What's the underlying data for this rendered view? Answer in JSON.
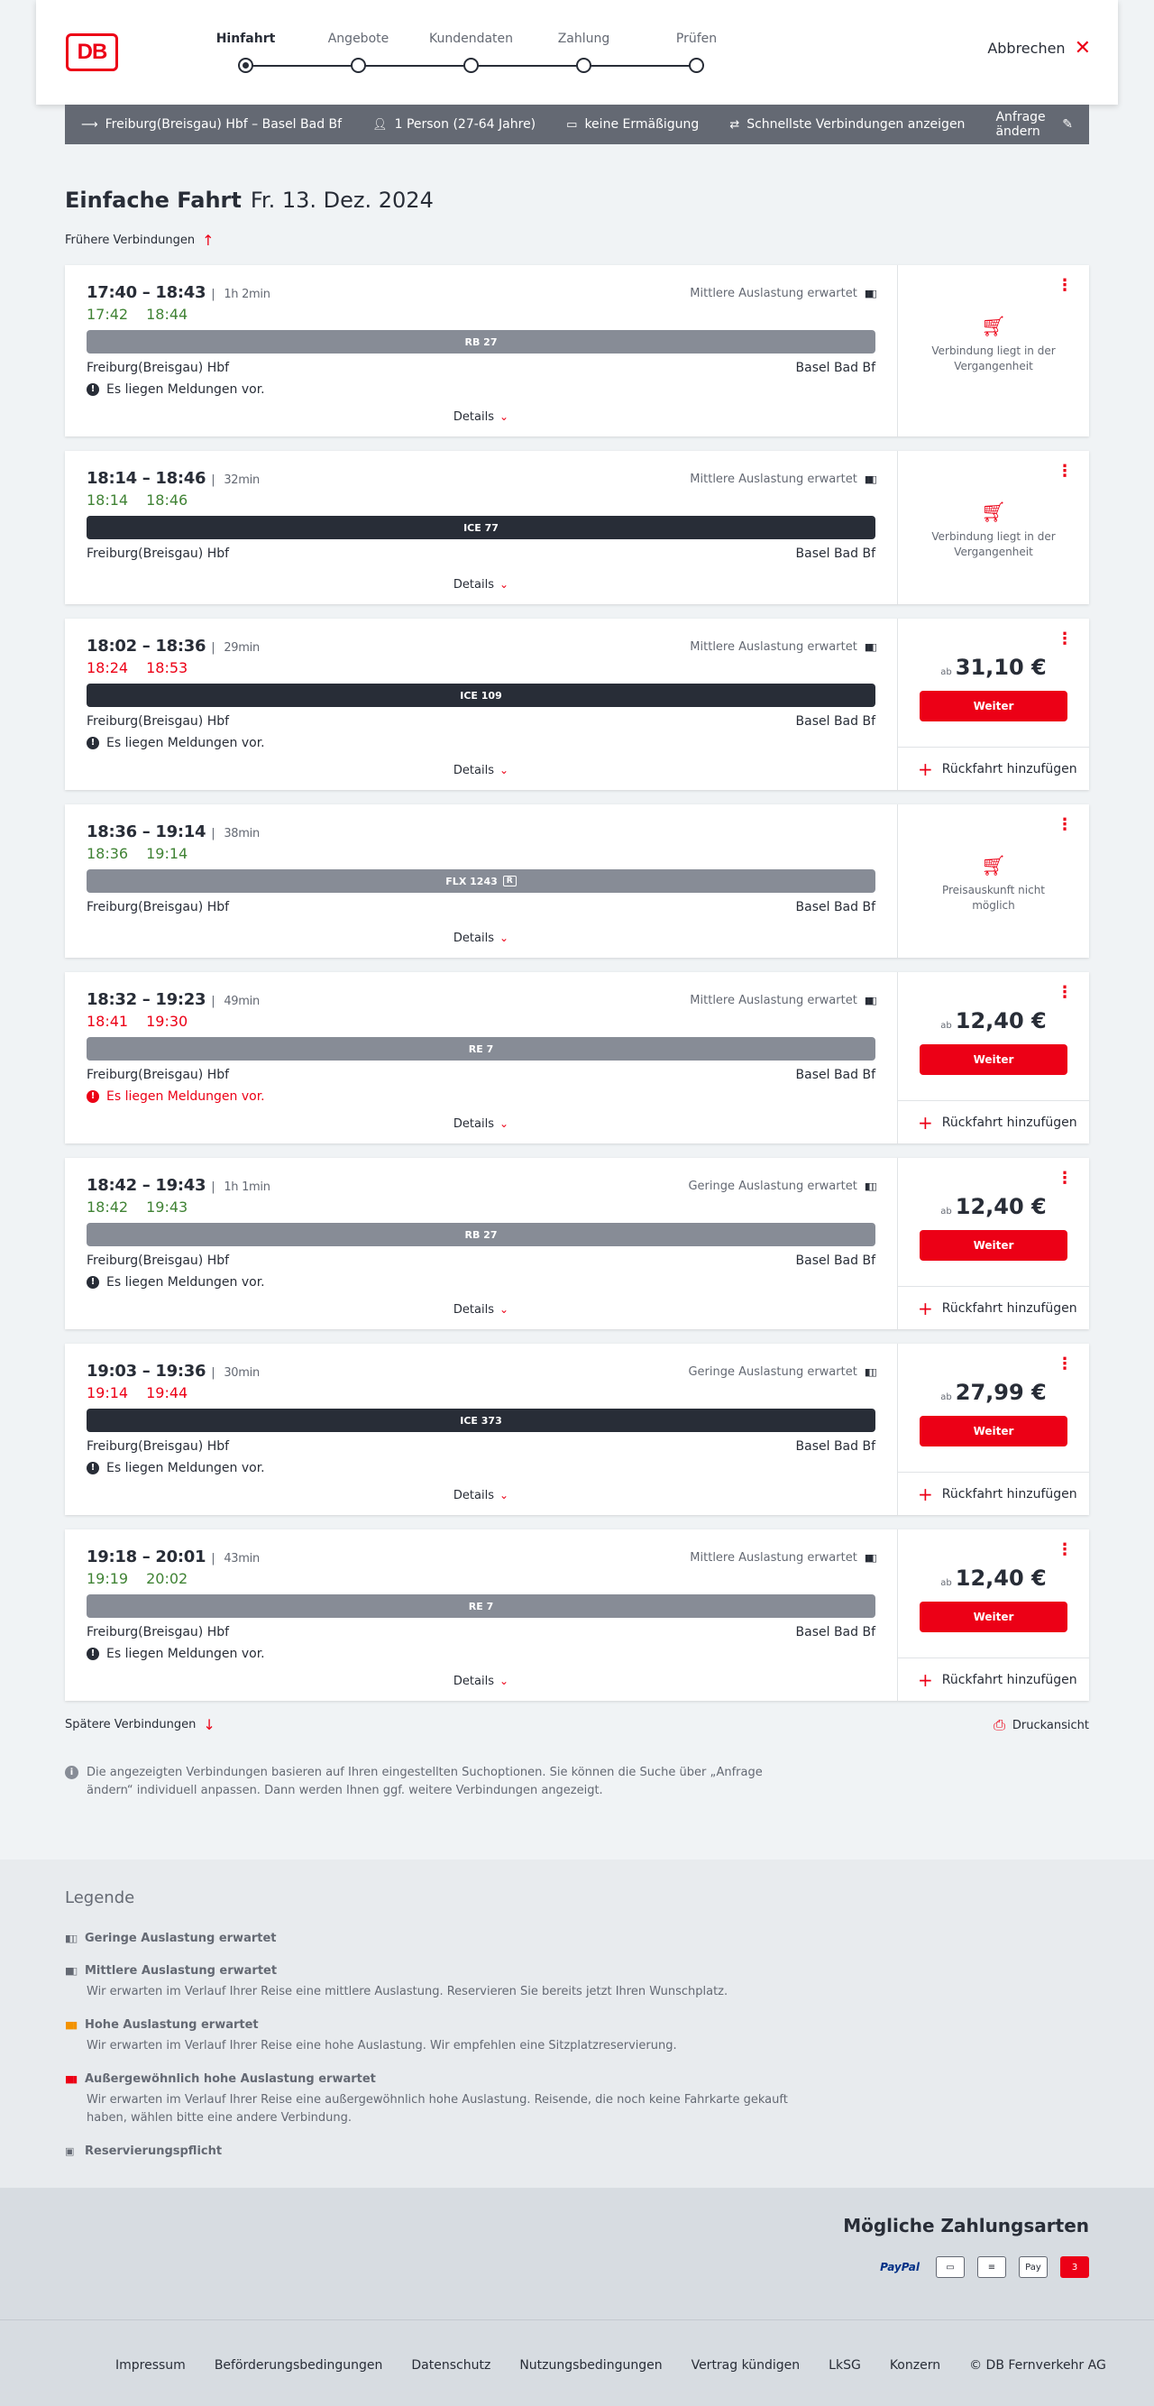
{
  "header": {
    "logo": "DB",
    "steps": [
      {
        "label": "Hinfahrt",
        "active": true
      },
      {
        "label": "Angebote",
        "active": false
      },
      {
        "label": "Kundendaten",
        "active": false
      },
      {
        "label": "Zahlung",
        "active": false
      },
      {
        "label": "Prüfen",
        "active": false
      }
    ],
    "cancel_label": "Abbrechen"
  },
  "searchbar": {
    "route": "Freiburg(Breisgau) Hbf – Basel Bad Bf",
    "travellers": "1 Person (27-64 Jahre)",
    "discount": "keine Ermäßigung",
    "option": "Schnellste Verbindungen anzeigen",
    "change": "Anfrage ändern"
  },
  "title": {
    "main": "Einfache Fahrt",
    "date": "Fr. 13. Dez. 2024"
  },
  "earlier_label": "Frühere Verbindungen",
  "later_label": "Spätere Verbindungen",
  "print_label": "Druckansicht",
  "labels": {
    "details": "Details",
    "weiter": "Weiter",
    "ab": "ab",
    "return": "Rückfahrt hinzufügen"
  },
  "connections": [
    {
      "times": "17:40 – 18:43",
      "duration": "1h 2min",
      "load": "Mittlere Auslastung erwartet",
      "rt_dep": "17:42",
      "rt_arr": "18:44",
      "dep_status": "ok",
      "arr_status": "ok",
      "train": "RB 27",
      "bar": "grey",
      "from": "Freiburg(Breisgau) Hbf",
      "to": "Basel Bad Bf",
      "message": "Es liegen Meldungen vor.",
      "msg_red": false,
      "state": "na",
      "na_text": "Verbindung liegt in der Vergangenheit"
    },
    {
      "times": "18:14 – 18:46",
      "duration": "32min",
      "load": "Mittlere Auslastung erwartet",
      "rt_dep": "18:14",
      "rt_arr": "18:46",
      "dep_status": "ok",
      "arr_status": "ok",
      "train": "ICE 77",
      "bar": "dark",
      "from": "Freiburg(Breisgau) Hbf",
      "to": "Basel Bad Bf",
      "message": "",
      "msg_red": false,
      "state": "na",
      "na_text": "Verbindung liegt in der Vergangenheit"
    },
    {
      "times": "18:02 – 18:36",
      "duration": "29min",
      "load": "Mittlere Auslastung erwartet",
      "rt_dep": "18:24",
      "rt_arr": "18:53",
      "dep_status": "late",
      "arr_status": "late",
      "train": "ICE 109",
      "bar": "dark",
      "from": "Freiburg(Breisgau) Hbf",
      "to": "Basel Bad Bf",
      "message": "Es liegen Meldungen vor.",
      "msg_red": false,
      "state": "price",
      "price": "31,10 €"
    },
    {
      "times": "18:36 – 19:14",
      "duration": "38min",
      "load": "",
      "rt_dep": "18:36",
      "rt_arr": "19:14",
      "dep_status": "ok",
      "arr_status": "ok",
      "train": "FLX 1243",
      "train_badge": "R",
      "bar": "grey",
      "from": "Freiburg(Breisgau) Hbf",
      "to": "Basel Bad Bf",
      "message": "",
      "msg_red": false,
      "state": "na",
      "na_text": "Preisauskunft nicht möglich"
    },
    {
      "times": "18:32 – 19:23",
      "duration": "49min",
      "load": "Mittlere Auslastung erwartet",
      "rt_dep": "18:41",
      "rt_arr": "19:30",
      "dep_status": "late",
      "arr_status": "late",
      "train": "RE 7",
      "bar": "grey",
      "from": "Freiburg(Breisgau) Hbf",
      "to": "Basel Bad Bf",
      "message": "Es liegen Meldungen vor.",
      "msg_red": true,
      "state": "price",
      "price": "12,40 €"
    },
    {
      "times": "18:42 – 19:43",
      "duration": "1h 1min",
      "load": "Geringe Auslastung erwartet",
      "rt_dep": "18:42",
      "rt_arr": "19:43",
      "dep_status": "ok",
      "arr_status": "ok",
      "train": "RB 27",
      "bar": "grey",
      "from": "Freiburg(Breisgau) Hbf",
      "to": "Basel Bad Bf",
      "message": "Es liegen Meldungen vor.",
      "msg_red": false,
      "state": "price",
      "price": "12,40 €"
    },
    {
      "times": "19:03 – 19:36",
      "duration": "30min",
      "load": "Geringe Auslastung erwartet",
      "rt_dep": "19:14",
      "rt_arr": "19:44",
      "dep_status": "late",
      "arr_status": "late",
      "train": "ICE 373",
      "bar": "dark",
      "from": "Freiburg(Breisgau) Hbf",
      "to": "Basel Bad Bf",
      "message": "Es liegen Meldungen vor.",
      "msg_red": false,
      "state": "price",
      "price": "27,99 €"
    },
    {
      "times": "19:18 – 20:01",
      "duration": "43min",
      "load": "Mittlere Auslastung erwartet",
      "rt_dep": "19:19",
      "rt_arr": "20:02",
      "dep_status": "ok",
      "arr_status": "ok",
      "train": "RE 7",
      "bar": "grey",
      "from": "Freiburg(Breisgau) Hbf",
      "to": "Basel Bad Bf",
      "message": "Es liegen Meldungen vor.",
      "msg_red": false,
      "state": "price",
      "price": "12,40 €"
    }
  ],
  "info_text": "Die angezeigten Verbindungen basieren auf Ihren eingestellten Suchoptionen. Sie können die Suche über „Anfrage ändern“ individuell anpassen. Dann werden Ihnen ggf. weitere Verbindungen angezeigt.",
  "legend": {
    "title": "Legende",
    "items": [
      {
        "title": "Geringe Auslastung erwartet",
        "text": "",
        "icon": "load-low-icon"
      },
      {
        "title": "Mittlere Auslastung erwartet",
        "text": "Wir erwarten im Verlauf Ihrer Reise eine mittlere Auslastung. Reservieren Sie bereits jetzt Ihren Wunschplatz.",
        "icon": "load-medium-icon"
      },
      {
        "title": "Hohe Auslastung erwartet",
        "text": "Wir erwarten im Verlauf Ihrer Reise eine hohe Auslastung. Wir empfehlen eine Sitzplatzreservierung.",
        "icon": "load-high-icon"
      },
      {
        "title": "Außergewöhnlich hohe Auslastung erwartet",
        "text": "Wir erwarten im Verlauf Ihrer Reise eine außergewöhnlich hohe Auslastung. Reisende, die noch keine Fahrkarte gekauft haben, wählen bitte eine andere Verbindung.",
        "icon": "load-extreme-icon"
      },
      {
        "title": "Reservierungspflicht",
        "text": "",
        "icon": "reservation-icon"
      }
    ]
  },
  "payment": {
    "title": "Mögliche Zahlungsarten",
    "methods": [
      "PayPal",
      "Kreditkarte",
      "SEPA",
      "Apple Pay",
      "DB"
    ]
  },
  "footer": {
    "links": [
      "Impressum",
      "Beförderungsbedingungen",
      "Datenschutz",
      "Nutzungsbedingungen",
      "Vertrag kündigen",
      "LkSG",
      "Konzern",
      "© DB Fernverkehr AG"
    ]
  },
  "colors": {
    "accent": "#ec0016",
    "on_time": "#408335",
    "late": "#ec0016",
    "dark": "#282d37",
    "grey_bar": "#878c96"
  }
}
